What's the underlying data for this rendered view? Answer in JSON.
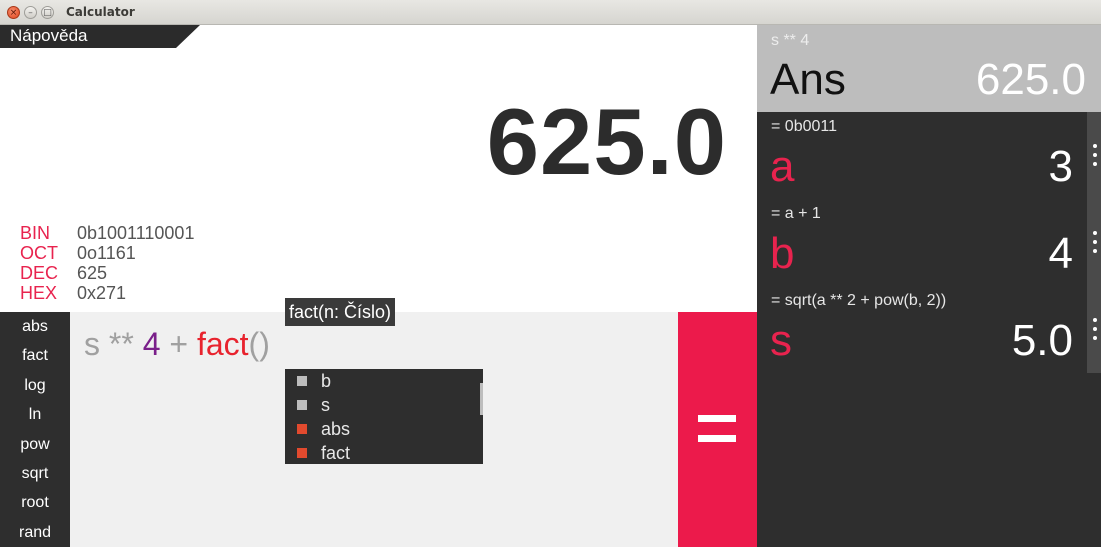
{
  "window": {
    "title": "Calculator",
    "close_glyph": "×",
    "min_glyph": "–",
    "max_glyph": "□"
  },
  "help_tab": {
    "label": "Nápověda"
  },
  "display": {
    "result": "625.0",
    "bases": [
      {
        "label": "BIN",
        "value": "0b1001110001"
      },
      {
        "label": "OCT",
        "value": "0o1161"
      },
      {
        "label": "DEC",
        "value": "625"
      },
      {
        "label": "HEX",
        "value": "0x271"
      }
    ]
  },
  "functions": [
    "abs",
    "fact",
    "log",
    "ln",
    "pow",
    "sqrt",
    "root",
    "rand"
  ],
  "input": {
    "tokens": {
      "t1": "s",
      "t2": " ** ",
      "t3": "4",
      "t4": " + ",
      "t5": "fact",
      "t6": "()"
    }
  },
  "tooltip": "fact(n: Číslo)",
  "completer": {
    "items": [
      {
        "label": "b",
        "color": "#bdbdbd"
      },
      {
        "label": "s",
        "color": "#bdbdbd"
      },
      {
        "label": "abs",
        "color": "#e24a2e"
      },
      {
        "label": "fact",
        "color": "#e24a2e"
      }
    ]
  },
  "equals_button": {
    "icon": "equals-icon"
  },
  "answer": {
    "expression": "s ** 4",
    "name": "Ans",
    "value": "625.0"
  },
  "variables": [
    {
      "expression": "= 0b0011",
      "name": "a",
      "value": "3"
    },
    {
      "expression": "= a + 1",
      "name": "b",
      "value": "4"
    },
    {
      "expression": "= sqrt(a ** 2 + pow(b, 2))",
      "name": "s",
      "value": "5.0"
    }
  ],
  "colors": {
    "accent": "#ec1a4b",
    "dark": "#2e2e2e",
    "var_name": "#e8234e"
  }
}
